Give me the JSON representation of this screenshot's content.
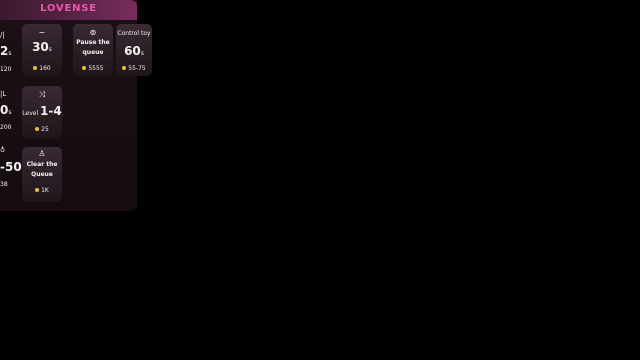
{
  "panel": {
    "brand": "LOVENSE",
    "brand_color": "#e85aa8",
    "coin_color": "#e8c22a"
  },
  "partial_cards": [
    {
      "icon": "wave-icon",
      "value_main": "2",
      "value_unit": "s",
      "price": "120"
    },
    {
      "icon": "wave-icon",
      "value_main": "0",
      "value_unit": "s",
      "price": "200"
    },
    {
      "icon": "hold-icon",
      "value_main": "-50",
      "value_unit": "s",
      "price": "38"
    }
  ],
  "cards": [
    {
      "icon": "~",
      "value_main": "30",
      "value_unit": "s",
      "price": "160"
    },
    {
      "icon": "⊚",
      "name": "Pause the queue",
      "price": "5555"
    },
    {
      "name": "Control toy",
      "value_main": "60",
      "value_unit": "s",
      "price": "55-75"
    },
    {
      "icon": "⤨",
      "value_prefix": "Level ",
      "value_main": "1-4",
      "price": "25"
    },
    {
      "icon": "♙",
      "name": "Clear the Queue",
      "price": "1K"
    }
  ]
}
